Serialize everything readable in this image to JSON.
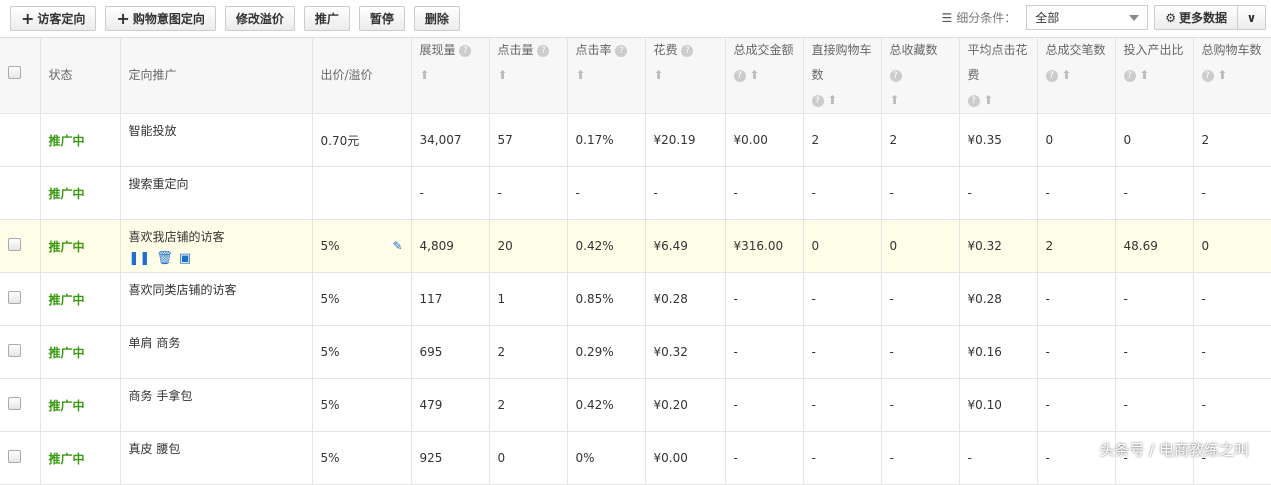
{
  "toolbar": {
    "add_visitor": "访客定向",
    "add_intent": "购物意图定向",
    "modify_premium": "修改溢价",
    "promote": "推广",
    "pause": "暂停",
    "delete": "删除",
    "segment_label": "细分条件：",
    "segment_value": "全部",
    "more_data": "更多数据"
  },
  "columns": [
    "状态",
    "定向推广",
    "出价/溢价",
    "展现量",
    "点击量",
    "点击率",
    "花费",
    "总成交金额",
    "直接购物车数",
    "总收藏数",
    "平均点击花费",
    "总成交笔数",
    "投入产出比",
    "总购物车数"
  ],
  "rows": [
    {
      "status": "推广中",
      "name": "智能投放",
      "bid": "0.70元",
      "vals": [
        "34,007",
        "57",
        "0.17%",
        "¥20.19",
        "¥0.00",
        "2",
        "2",
        "¥0.35",
        "0",
        "0",
        "2"
      ],
      "checkbox": false
    },
    {
      "status": "推广中",
      "name": "搜索重定向",
      "bid": "",
      "vals": [
        "-",
        "-",
        "-",
        "-",
        "-",
        "-",
        "-",
        "-",
        "-",
        "-",
        "-"
      ],
      "checkbox": false
    },
    {
      "status": "推广中",
      "name": "喜欢我店铺的访客",
      "bid": "5%",
      "vals": [
        "4,809",
        "20",
        "0.42%",
        "¥6.49",
        "¥316.00",
        "0",
        "0",
        "¥0.32",
        "2",
        "48.69",
        "0"
      ],
      "checkbox": true,
      "highlight": true
    },
    {
      "status": "推广中",
      "name": "喜欢同类店铺的访客",
      "bid": "5%",
      "vals": [
        "117",
        "1",
        "0.85%",
        "¥0.28",
        "-",
        "-",
        "-",
        "¥0.28",
        "-",
        "-",
        "-"
      ],
      "checkbox": true
    },
    {
      "status": "推广中",
      "name": "单肩 商务",
      "bid": "5%",
      "vals": [
        "695",
        "2",
        "0.29%",
        "¥0.32",
        "-",
        "-",
        "-",
        "¥0.16",
        "-",
        "-",
        "-"
      ],
      "checkbox": true
    },
    {
      "status": "推广中",
      "name": "商务 手拿包",
      "bid": "5%",
      "vals": [
        "479",
        "2",
        "0.42%",
        "¥0.20",
        "-",
        "-",
        "-",
        "¥0.10",
        "-",
        "-",
        "-"
      ],
      "checkbox": true
    },
    {
      "status": "推广中",
      "name": "真皮 腰包",
      "bid": "5%",
      "vals": [
        "925",
        "0",
        "0%",
        "¥0.00",
        "-",
        "-",
        "-",
        "-",
        "-",
        "-",
        "-"
      ],
      "checkbox": true
    }
  ],
  "watermark": "头条号 / 电商教练之叫"
}
